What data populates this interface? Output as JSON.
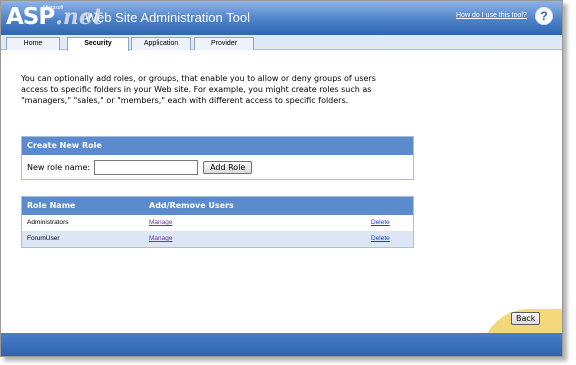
{
  "header": {
    "logo_main": "ASP",
    "logo_microsoft": "Microsoft",
    "logo_net": ".net",
    "title": "Web Site Administration Tool",
    "help_link": "How do I use this tool?",
    "help_icon": "?"
  },
  "tabs": [
    {
      "label": "Home",
      "active": false
    },
    {
      "label": "Security",
      "active": true
    },
    {
      "label": "Application",
      "active": false
    },
    {
      "label": "Provider",
      "active": false
    }
  ],
  "intro_text": "You can optionally add roles, or groups, that enable you to allow or deny groups of users access to specific folders in your Web site. For example, you might create roles such as \"managers,\" \"sales,\" or \"members,\" each with different access to specific folders.",
  "create_role": {
    "heading": "Create New Role",
    "label": "New role name:",
    "value": "",
    "button": "Add Role"
  },
  "roles_table": {
    "columns": [
      "Role Name",
      "Add/Remove Users"
    ],
    "rows": [
      {
        "name": "Administrators",
        "manage": "Manage",
        "delete": "Delete"
      },
      {
        "name": "ForumUser",
        "manage": "Manage",
        "delete": "Delete"
      }
    ]
  },
  "footer": {
    "back_button": "Back"
  },
  "colors": {
    "header_blue": "#4d82c8",
    "panel_blue": "#5b8bcc",
    "footer_yellow": "#f4d97a"
  }
}
